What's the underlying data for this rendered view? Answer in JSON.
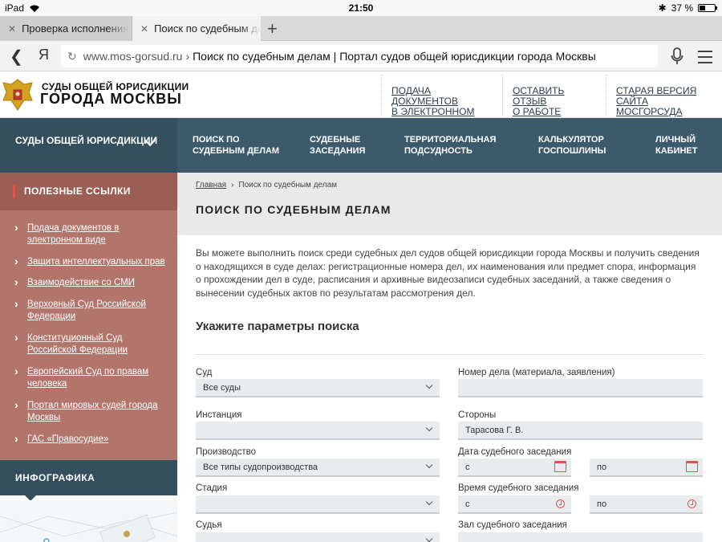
{
  "status_bar": {
    "device": "iPad",
    "time": "21:50",
    "battery": "37 %",
    "battery_level": 0.37
  },
  "tabs": [
    {
      "label": "Проверка исполнения"
    },
    {
      "label": "Поиск по судебным делам"
    }
  ],
  "address_bar": {
    "search_engine": "Я",
    "domain": "www.mos-gorsud.ru",
    "separator": "›",
    "page_title": "Поиск по судебным делам | Портал судов общей юрисдикции города Москвы"
  },
  "site_header": {
    "brand_line1": "СУДЫ ОБЩЕЙ ЮРИСДИКЦИИ",
    "brand_line2": "ГОРОДА МОСКВЫ",
    "links": [
      {
        "line1": "ПОДАЧА ДОКУМЕНТОВ",
        "line2": "В ЭЛЕКТРОННОМ ВИДЕ"
      },
      {
        "line1": "ОСТАВИТЬ ОТЗЫВ",
        "line2": "О РАБОТЕ ПОРТАЛА"
      },
      {
        "line1": "СТАРАЯ ВЕРСИЯ",
        "line2": "САЙТА МОСГОРСУДА"
      }
    ]
  },
  "main_nav": {
    "courts": "СУДЫ ОБЩЕЙ ЮРИСДИКЦИИ",
    "items": [
      {
        "line1": "ПОИСК ПО",
        "line2": "СУДЕБНЫМ ДЕЛАМ"
      },
      {
        "line1": "СУДЕБНЫЕ",
        "line2": "ЗАСЕДАНИЯ"
      },
      {
        "line1": "ТЕРРИТОРИАЛЬНАЯ",
        "line2": "ПОДСУДНОСТЬ"
      },
      {
        "line1": "КАЛЬКУЛЯТОР",
        "line2": "ГОСПОШЛИНЫ"
      },
      {
        "line1": "ЛИЧНЫЙ",
        "line2": "КАБИНЕТ"
      }
    ]
  },
  "sidebar": {
    "useful_links_title": "ПОЛЕЗНЫЕ ССЫЛКИ",
    "links": [
      "Подача документов в электронном виде",
      "Защита интеллектуальных прав",
      "Взаимодействие со СМИ",
      "Верховный Суд Российской Федерации",
      "Конституционный Суд Российской Федерации",
      "Европейский Суд по правам человека",
      "Портал мировых судей города Москвы",
      "ГАС «Правосудие»"
    ],
    "infographics_title": "ИНФОГРАФИКА"
  },
  "content": {
    "breadcrumb": {
      "home": "Главная",
      "sep": "›",
      "current": "Поиск по судебным делам"
    },
    "title": "ПОИСК ПО СУДЕБНЫМ ДЕЛАМ",
    "description": "Вы можете выполнить поиск среди судебных дел судов общей юрисдикции города Москвы и получить сведения о находящихся в суде делах: регистрационные номера дел, их наименования или предмет спора, информация о прохождении дел в суде, расписания и архивные видеозаписи судебных заседаний, а также сведения о вынесении судебных актов по результатам рассмотрения дел.",
    "form_title": "Укажите параметры поиска",
    "form": {
      "court_label": "Суд",
      "court_value": "Все суды",
      "case_number_label": "Номер дела (материала, заявления)",
      "case_number_value": "",
      "instance_label": "Инстанция",
      "instance_value": "",
      "parties_label": "Стороны",
      "parties_value": "Тарасова Г. В.",
      "proceeding_label": "Производство",
      "proceeding_value": "Все типы судопроизводства",
      "hearing_date_label": "Дата судебного заседания",
      "date_from": "с",
      "date_to": "по",
      "stage_label": "Стадия",
      "stage_value": "",
      "hearing_time_label": "Время судебного заседания",
      "time_from": "с",
      "time_to": "по",
      "judge_label": "Судья",
      "hall_label": "Зал судебного заседания"
    }
  }
}
